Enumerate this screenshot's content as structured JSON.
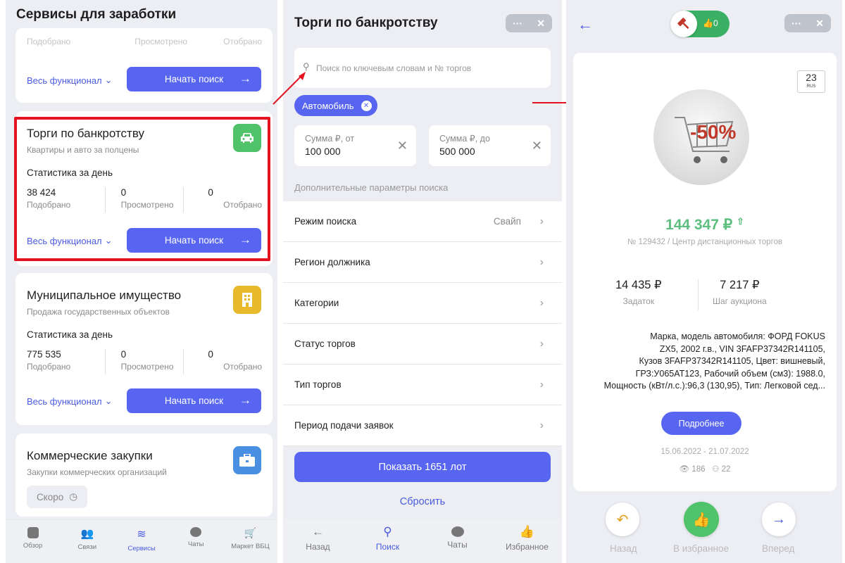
{
  "services": {
    "title": "Сервисы для заработки",
    "top_card": {
      "ghost": [
        "Подобрано",
        "Просмотрено",
        "Отобрано"
      ],
      "func": "Весь функционал",
      "start": "Начать поиск"
    },
    "cards": [
      {
        "title": "Торги по банкротству",
        "sub": "Квартиры и авто за полцены",
        "stat_h": "Статистика за день",
        "stats": [
          {
            "v": "38 424",
            "l": "Подобрано"
          },
          {
            "v": "0",
            "l": "Просмотрено"
          },
          {
            "v": "0",
            "l": "Отобрано"
          }
        ],
        "func": "Весь функционал",
        "start": "Начать поиск",
        "icon": "car-icon",
        "color": "#4fc26a"
      },
      {
        "title": "Муниципальное имущество",
        "sub": "Продажа государственных объектов",
        "stat_h": "Статистика за день",
        "stats": [
          {
            "v": "775 535",
            "l": "Подобрано"
          },
          {
            "v": "0",
            "l": "Просмотрено"
          },
          {
            "v": "0",
            "l": "Отобрано"
          }
        ],
        "func": "Весь функционал",
        "start": "Начать поиск",
        "icon": "building-icon",
        "color": "#e8b92a"
      },
      {
        "title": "Коммерческие закупки",
        "sub": "Закупки коммерческих организаций",
        "soon": "Скоро",
        "icon": "briefcase-icon",
        "color": "#4a90e2"
      }
    ],
    "tabs": [
      {
        "label": "Обзор"
      },
      {
        "label": "Связи"
      },
      {
        "label": "Сервисы"
      },
      {
        "label": "Чаты"
      },
      {
        "label": "Маркет ВБЦ"
      }
    ]
  },
  "search": {
    "title": "Торги по банкротству",
    "placeholder": "Поиск по ключевым словам и № торгов",
    "chip": "Автомобиль",
    "from_label": "Сумма ₽, от",
    "from_value": "100 000",
    "to_label": "Сумма ₽, до",
    "to_value": "500 000",
    "section": "Дополнительные параметры поиска",
    "rows": [
      {
        "label": "Режим поиска",
        "value": "Свайп"
      },
      {
        "label": "Регион должника",
        "value": ""
      },
      {
        "label": "Категории",
        "value": ""
      },
      {
        "label": "Статус торгов",
        "value": ""
      },
      {
        "label": "Тип торгов",
        "value": ""
      },
      {
        "label": "Период подачи заявок",
        "value": ""
      }
    ],
    "show": "Показать 1651 лот",
    "reset": "Сбросить",
    "tabs": [
      {
        "label": "Назад"
      },
      {
        "label": "Поиск"
      },
      {
        "label": "Чаты"
      },
      {
        "label": "Избранное"
      }
    ]
  },
  "lot": {
    "likes": "0",
    "plate": "23",
    "plate_sub": "RUS",
    "price": "144 347 ₽",
    "meta": "№ 129432 / Центр дистанционных торгов",
    "deposit": "14 435 ₽",
    "deposit_label": "Задаток",
    "step": "7 217 ₽",
    "step_label": "Шаг аукциона",
    "desc": [
      "Марка, модель автомобиля: ФОРД FOKUS",
      "ZX5, 2002 г.в., VIN 3FAFP37342R141105,",
      "Кузов 3FAFP37342R141105, Цвет: вишневый,",
      "ГРЗ:У065АТ123, Рабочий объем (см3): 1988.0,",
      "Мощность (кВт/л.с.):96,3 (130,95), Тип: Легковой сед..."
    ],
    "more": "Подробнее",
    "dates": "15.06.2022 - 21.07.2022",
    "views": "186",
    "users": "22",
    "back": "Назад",
    "fav": "В избранное",
    "next": "Вперед"
  },
  "colors": {
    "accent": "#5765f0",
    "green": "#5cbf7f",
    "highlight": "#e3121e"
  }
}
